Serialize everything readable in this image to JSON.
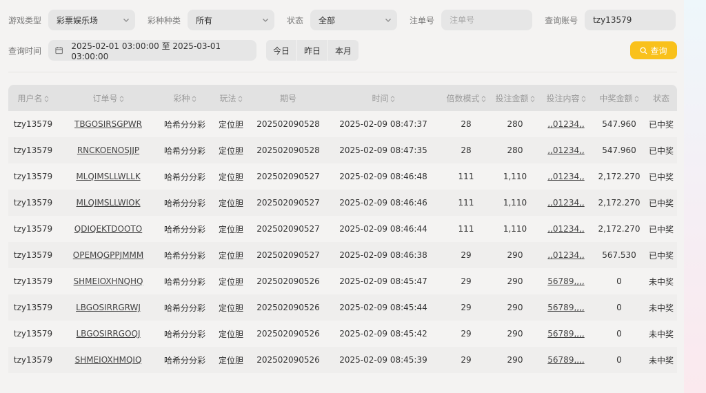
{
  "filters": {
    "game_type_label": "游戏类型",
    "game_type_value": "彩票娱乐场",
    "lottery_label": "彩种种类",
    "lottery_value": "所有",
    "status_label": "状态",
    "status_value": "全部",
    "order_no_label": "注单号",
    "order_no_placeholder": "注单号",
    "account_label": "查询账号",
    "account_value": "tzy13579",
    "time_label": "查询时间",
    "date_range": "2025-02-01 03:00:00 至 2025-03-01 03:00:00",
    "quick": [
      "今日",
      "昨日",
      "本月"
    ],
    "search_label": "查询"
  },
  "table": {
    "headers": [
      "用户名",
      "订单号",
      "彩种",
      "玩法",
      "期号",
      "时间",
      "倍数模式",
      "投注金额",
      "投注内容",
      "中奖金额",
      "状态"
    ],
    "rows": [
      [
        "tzy13579",
        "TBGOSIRSGPWR",
        "哈希分分彩",
        "定位胆",
        "202502090528",
        "2025-02-09 08:47:37",
        "28",
        "280",
        ",,01234,,",
        "547.960",
        "已中奖"
      ],
      [
        "tzy13579",
        "RNCKOENOSJJP",
        "哈希分分彩",
        "定位胆",
        "202502090528",
        "2025-02-09 08:47:35",
        "28",
        "280",
        ",,01234,,",
        "547.960",
        "已中奖"
      ],
      [
        "tzy13579",
        "MLQIMSLLWLLK",
        "哈希分分彩",
        "定位胆",
        "202502090527",
        "2025-02-09 08:46:48",
        "111",
        "1,110",
        ",,01234,,",
        "2,172.270",
        "已中奖"
      ],
      [
        "tzy13579",
        "MLQIMSLLWIOK",
        "哈希分分彩",
        "定位胆",
        "202502090527",
        "2025-02-09 08:46:46",
        "111",
        "1,110",
        ",,01234,,",
        "2,172.270",
        "已中奖"
      ],
      [
        "tzy13579",
        "QDIQEKTDOOTO",
        "哈希分分彩",
        "定位胆",
        "202502090527",
        "2025-02-09 08:46:44",
        "111",
        "1,110",
        ",,01234,,",
        "2,172.270",
        "已中奖"
      ],
      [
        "tzy13579",
        "OPEMQGPPJMMM",
        "哈希分分彩",
        "定位胆",
        "202502090527",
        "2025-02-09 08:46:38",
        "29",
        "290",
        ",,01234,,",
        "567.530",
        "已中奖"
      ],
      [
        "tzy13579",
        "SHMEIOXHNQHQ",
        "哈希分分彩",
        "定位胆",
        "202502090526",
        "2025-02-09 08:45:47",
        "29",
        "290",
        "56789,,,,",
        "0",
        "未中奖"
      ],
      [
        "tzy13579",
        "LBGOSIRRGRWJ",
        "哈希分分彩",
        "定位胆",
        "202502090526",
        "2025-02-09 08:45:44",
        "29",
        "290",
        "56789,,,,",
        "0",
        "未中奖"
      ],
      [
        "tzy13579",
        "LBGOSIRRGOQJ",
        "哈希分分彩",
        "定位胆",
        "202502090526",
        "2025-02-09 08:45:42",
        "29",
        "290",
        "56789,,,,",
        "0",
        "未中奖"
      ],
      [
        "tzy13579",
        "SHMEIOXHMQIQ",
        "哈希分分彩",
        "定位胆",
        "202502090526",
        "2025-02-09 08:45:39",
        "29",
        "290",
        "56789,,,,",
        "0",
        "未中奖"
      ]
    ]
  },
  "colors": {
    "accent": "#f9c11b",
    "header_bg": "#e2e2e2",
    "input_bg": "#e6e6e6"
  },
  "icons": {
    "dropdown": "chevron-down-icon",
    "calendar": "calendar-icon",
    "search": "search-icon",
    "sort": "sort-icon"
  }
}
